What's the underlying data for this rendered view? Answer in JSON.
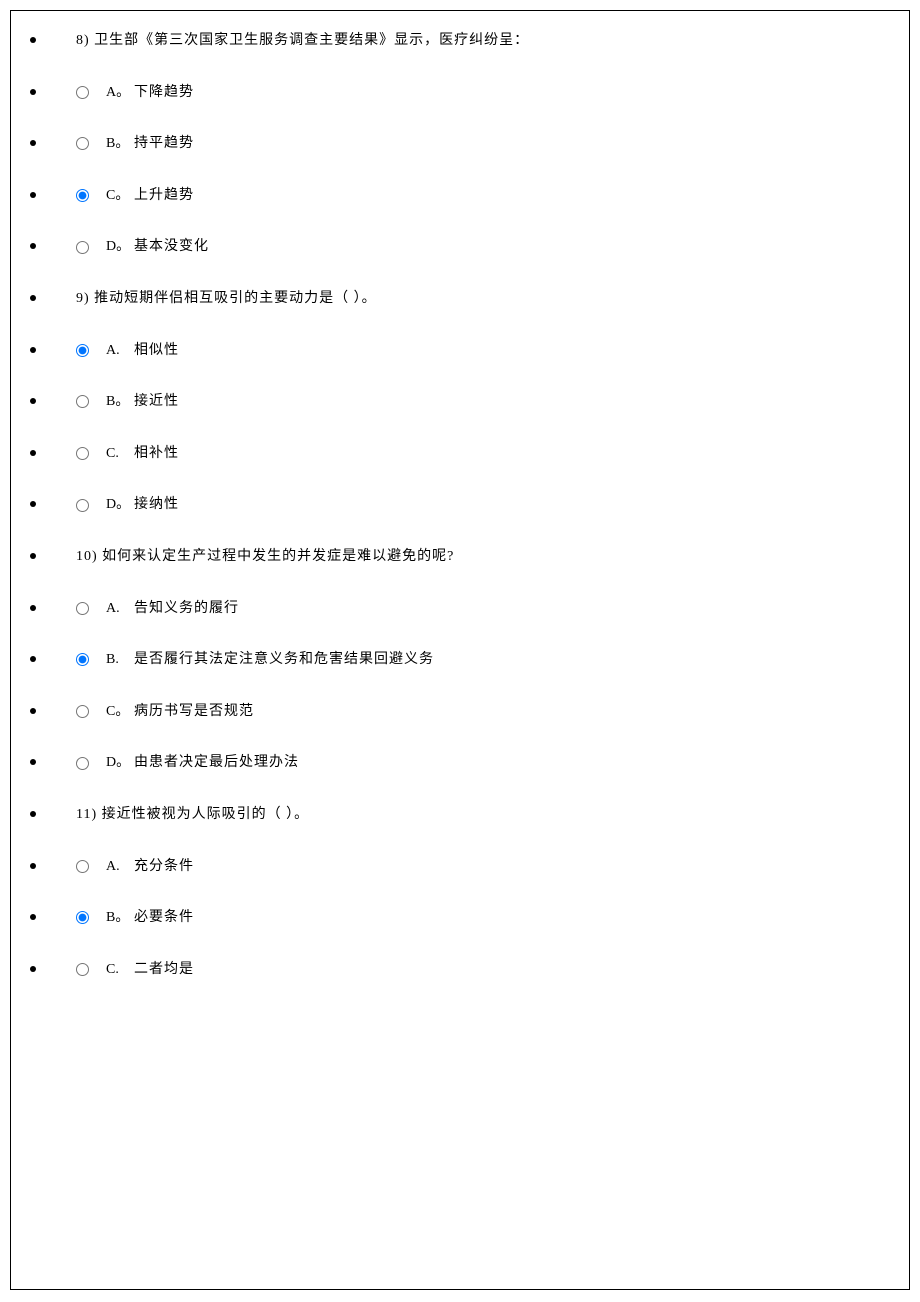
{
  "questions": [
    {
      "number": "8)",
      "text": "卫生部《第三次国家卫生服务调查主要结果》显示，医疗纠纷呈：",
      "selected": 2,
      "options": [
        {
          "letter": "A。",
          "text": "下降趋势"
        },
        {
          "letter": "B。",
          "text": "持平趋势"
        },
        {
          "letter": "C。",
          "text": "上升趋势"
        },
        {
          "letter": "D。",
          "text": "基本没变化"
        }
      ]
    },
    {
      "number": "9)",
      "text": "推动短期伴侣相互吸引的主要动力是（ ）。",
      "selected": 0,
      "options": [
        {
          "letter": "A.",
          "text": "相似性"
        },
        {
          "letter": "B。",
          "text": "接近性"
        },
        {
          "letter": "C.",
          "text": "相补性"
        },
        {
          "letter": "D。",
          "text": "接纳性"
        }
      ]
    },
    {
      "number": "10)",
      "text": "如何来认定生产过程中发生的并发症是难以避免的呢?",
      "selected": 1,
      "options": [
        {
          "letter": "A.",
          "text": "告知义务的履行"
        },
        {
          "letter": "B.",
          "text": "是否履行其法定注意义务和危害结果回避义务"
        },
        {
          "letter": "C。",
          "text": "病历书写是否规范"
        },
        {
          "letter": "D。",
          "text": "由患者决定最后处理办法"
        }
      ]
    },
    {
      "number": "11)",
      "text": "接近性被视为人际吸引的（ ）。",
      "selected": 1,
      "options": [
        {
          "letter": "A.",
          "text": "充分条件"
        },
        {
          "letter": "B。",
          "text": "必要条件"
        },
        {
          "letter": "C.",
          "text": "二者均是"
        }
      ]
    }
  ]
}
